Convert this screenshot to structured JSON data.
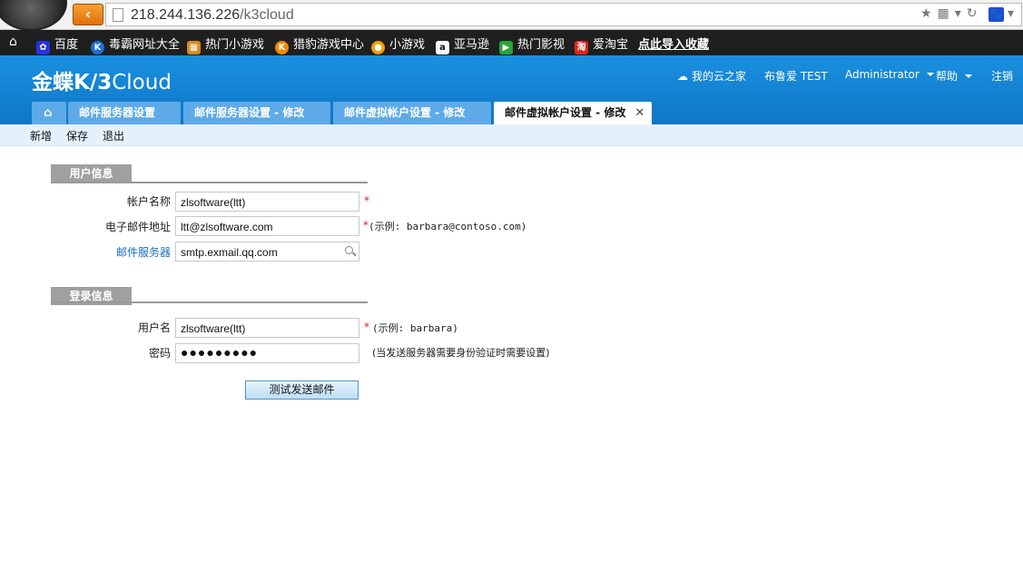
{
  "browser": {
    "url_host": "218.244.136.226",
    "url_path": "/k3cloud",
    "bookmarks": [
      {
        "label": "百度",
        "icon": "baidu-paw-icon",
        "color": "#2932e1"
      },
      {
        "label": "毒霸网址大全",
        "icon": "duba-k-icon",
        "color": "#1e6fd6"
      },
      {
        "label": "热门小游戏",
        "icon": "game-grid-icon",
        "color": "#d9891b"
      },
      {
        "label": "猎豹游戏中心",
        "icon": "cheetah-icon",
        "color": "#f28a00"
      },
      {
        "label": "小游戏",
        "icon": "game-ball-icon",
        "color": "#f2a000"
      },
      {
        "label": "亚马逊",
        "icon": "amazon-a-icon",
        "color": "#111111"
      },
      {
        "label": "热门影视",
        "icon": "play-icon",
        "color": "#2aa43a"
      },
      {
        "label": "爱淘宝",
        "icon": "taobao-icon",
        "color": "#e2231a"
      },
      {
        "label": "点此导入收藏",
        "icon": "",
        "color": ""
      }
    ]
  },
  "app": {
    "logo_main": "金蝶K/3",
    "logo_sub": "Cloud",
    "links": {
      "my_cloud": "我的云之家",
      "user_org": "布鲁爱  TEST",
      "user": "Administrator",
      "help": "帮助",
      "logout": "注销"
    },
    "tabs": [
      {
        "label": "邮件服务器设置"
      },
      {
        "label": "邮件服务器设置 - 修改"
      },
      {
        "label": "邮件虚拟帐户设置 - 修改"
      },
      {
        "label": "邮件虚拟帐户设置 - 修改"
      }
    ],
    "toolbar": {
      "new": "新增",
      "save": "保存",
      "exit": "退出"
    }
  },
  "form": {
    "user_section": "用户信息",
    "account_name_label": "帐户名称",
    "account_name_value": "zlsoftware(ltt)",
    "email_label": "电子邮件地址",
    "email_value": "ltt@zlsoftware.com",
    "email_hint": "(示例: barbara@contoso.com)",
    "server_label": "邮件服务器",
    "server_value": "smtp.exmail.qq.com",
    "login_section": "登录信息",
    "username_label": "用户名",
    "username_value": "zlsoftware(ltt)",
    "username_hint": "(示例: barbara)",
    "password_label": "密码",
    "password_value": "●●●●●●●●●",
    "password_hint": "(当发送服务器需要身份验证时需要设置)",
    "required_mark": "*",
    "test_button": "测试发送邮件"
  }
}
